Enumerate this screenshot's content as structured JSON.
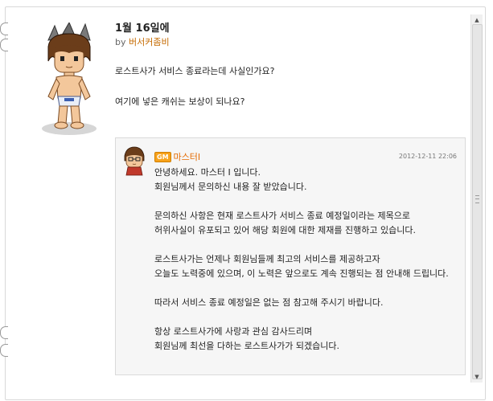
{
  "post": {
    "title": "1월 16일에",
    "by_prefix": "by",
    "author": "버서커좀비",
    "question_lines": [
      "로스트사가 서비스 종료라는데 사실인가요?",
      "여기에 넣은 캐쉬는 보상이 되나요?"
    ]
  },
  "answer": {
    "badge": "GM",
    "name": "마스터I",
    "date": "2012-12-11 22:06",
    "paragraphs": [
      [
        "안녕하세요. 마스터 I 입니다.",
        "회원님께서 문의하신 내용 잘 받았습니다."
      ],
      [
        "문의하신 사항은 현재 로스트사가 서비스 종료 예정일이라는 제목으로",
        "허위사실이 유포되고 있어 해당 회원에 대한 제재를 진행하고 있습니다."
      ],
      [
        "로스트사가는 언제나 회원님들께 최고의 서비스를 제공하고자",
        "오늘도 노력중에 있으며, 이 노력은 앞으로도 계속 진행되는 점 안내해 드립니다."
      ],
      [
        "따라서 서비스 종료 예정일은 없는 점 참고해 주시기 바랍니다."
      ],
      [
        "항상 로스트사가에 사랑과 관심 감사드리며",
        "회원님께 최선을 다하는 로스트사가가 되겠습니다."
      ]
    ]
  },
  "scrollbar": {
    "up_icon": "up-arrow-icon",
    "down_icon": "down-arrow-icon"
  }
}
